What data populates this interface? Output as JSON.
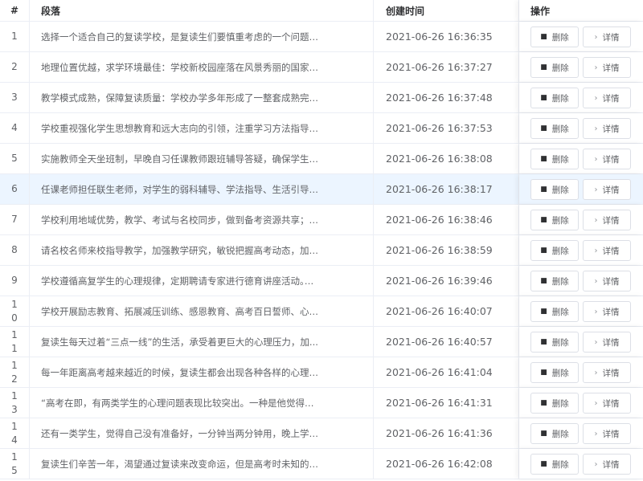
{
  "table": {
    "headers": {
      "index": "#",
      "paragraph": "段落",
      "created": "创建时间",
      "actions": "操作"
    },
    "delete_label": "删除",
    "detail_label": "详情",
    "rows": [
      {
        "index": "1",
        "paragraph": "选择一个适合自己的复读学校，是复读生们要慎重考虑的一个问题。...",
        "created": "2021-06-26 16:36:35"
      },
      {
        "index": "2",
        "paragraph": "地理位置优越，求学环境最佳：学校新校园座落在风景秀丽的国家级...",
        "created": "2021-06-26 16:37:27"
      },
      {
        "index": "3",
        "paragraph": "教学模式成熟，保障复读质量：学校办学多年形成了一整套成熟完备...",
        "created": "2021-06-26 16:37:48"
      },
      {
        "index": "4",
        "paragraph": "学校重视强化学生思想教育和远大志向的引领，注重学习方法指导和...",
        "created": "2021-06-26 16:37:53"
      },
      {
        "index": "5",
        "paragraph": "实施教师全天坐班制，早晚自习任课教师跟班辅导答疑，确保学生疑...",
        "created": "2021-06-26 16:38:08"
      },
      {
        "index": "6",
        "paragraph": "任课老师担任联生老师，对学生的弱科辅导、学法指导、生活引导、...",
        "created": "2021-06-26 16:38:17"
      },
      {
        "index": "7",
        "paragraph": "学校利用地域优势，教学、考试与名校同步，做到备考资源共享；学...",
        "created": "2021-06-26 16:38:46"
      },
      {
        "index": "8",
        "paragraph": "请名校名师来校指导教学，加强教学研究，敏锐把握高考动态，加强...",
        "created": "2021-06-26 16:38:59"
      },
      {
        "index": "9",
        "paragraph": "学校遵循高复学生的心理规律，定期聘请专家进行德育讲座活动。。...",
        "created": "2021-06-26 16:39:46"
      },
      {
        "index": "10",
        "paragraph": "学校开展励志教育、拓展减压训练、感恩教育、高考百日誓师、心理...",
        "created": "2021-06-26 16:40:07"
      },
      {
        "index": "11",
        "paragraph": "复读生每天过着“三点一线”的生活，承受着更巨大的心理压力，加...",
        "created": "2021-06-26 16:40:57"
      },
      {
        "index": "12",
        "paragraph": "每一年距离高考越来越近的时候，复读生都会出现各种各样的心理问...",
        "created": "2021-06-26 16:41:04"
      },
      {
        "index": "13",
        "paragraph": "“高考在即，有两类学生的心理问题表现比较突出。一种是他觉得自...",
        "created": "2021-06-26 16:41:31"
      },
      {
        "index": "14",
        "paragraph": "还有一类学生，觉得自己没有准备好，一分钟当两分钟用，晚上学习...",
        "created": "2021-06-26 16:41:36"
      },
      {
        "index": "15",
        "paragraph": "复读生们辛苦一年，渴望通过复读来改变命运，但是高考时未知的，...",
        "created": "2021-06-26 16:42:08"
      }
    ]
  },
  "icons": {
    "delete": "trash-icon",
    "detail": "chevron-right-icon"
  },
  "colors": {
    "border": "#ebeef5",
    "highlight_row": "#ecf5ff",
    "button_border": "#dcdfe6",
    "text": "#606266"
  }
}
